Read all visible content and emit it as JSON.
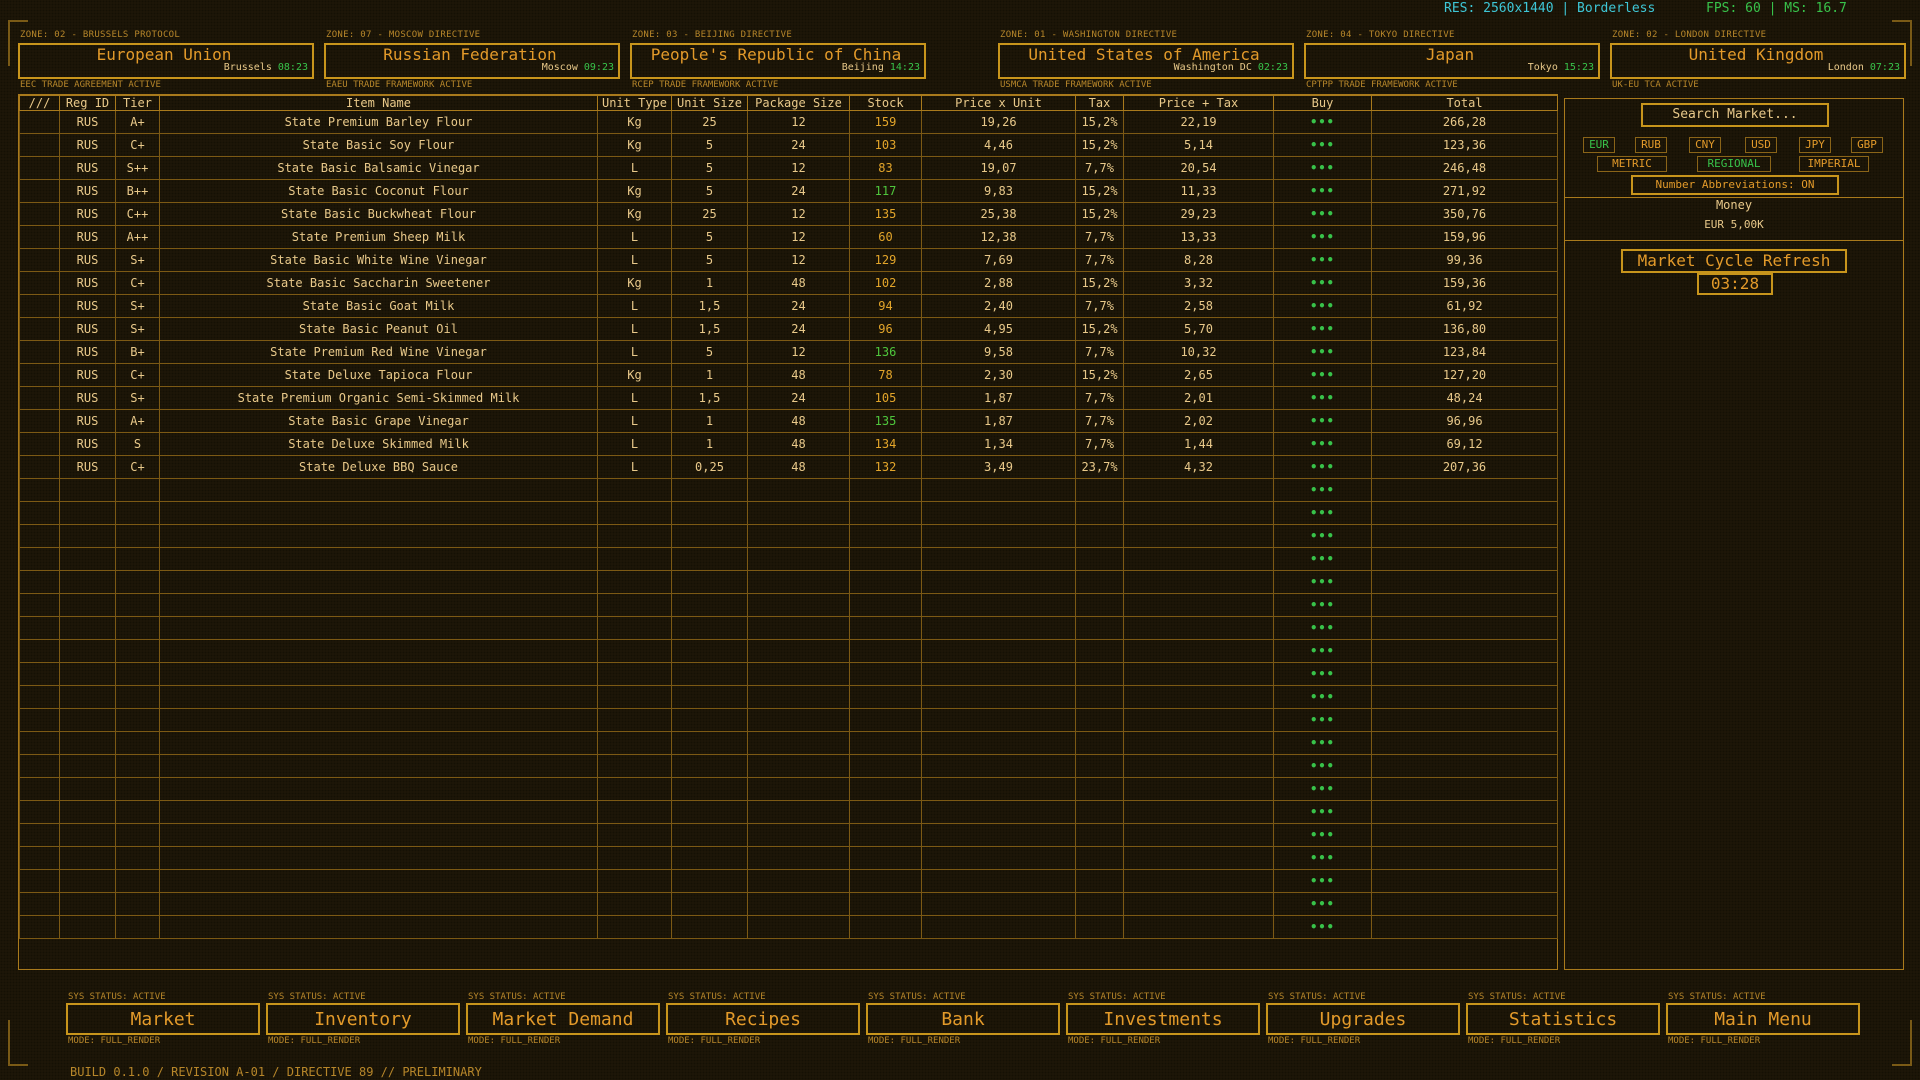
{
  "status": {
    "res": "RES: 2560x1440 | Borderless",
    "fps": "FPS: 60 | MS: 16.7"
  },
  "zones": [
    {
      "label": "ZONE: 02 - BRUSSELS PROTOCOL",
      "name": "European Union",
      "city": "Brussels",
      "time": "08:23",
      "footer": "EEC TRADE AGREEMENT ACTIVE"
    },
    {
      "label": "ZONE: 07 - MOSCOW DIRECTIVE",
      "name": "Russian Federation",
      "city": "Moscow",
      "time": "09:23",
      "footer": "EAEU TRADE FRAMEWORK ACTIVE"
    },
    {
      "label": "ZONE: 03 - BEIJING DIRECTIVE",
      "name": "People's Republic of China",
      "city": "Beijing",
      "time": "14:23",
      "footer": "RCEP TRADE FRAMEWORK ACTIVE"
    },
    {
      "label": "ZONE: 01 - WASHINGTON DIRECTIVE",
      "name": "United States of America",
      "city": "Washington DC",
      "time": "02:23",
      "footer": "USMCA TRADE FRAMEWORK ACTIVE"
    },
    {
      "label": "ZONE: 04 - TOKYO DIRECTIVE",
      "name": "Japan",
      "city": "Tokyo",
      "time": "15:23",
      "footer": "CPTPP TRADE FRAMEWORK ACTIVE"
    },
    {
      "label": "ZONE: 02 - LONDON DIRECTIVE",
      "name": "United Kingdom",
      "city": "London",
      "time": "07:23",
      "footer": "UK-EU TCA ACTIVE"
    }
  ],
  "table": {
    "headers": [
      "///",
      "Reg ID",
      "Tier",
      "Item Name",
      "Unit Type",
      "Unit Size",
      "Package Size",
      "Stock",
      "Price x Unit",
      "Tax",
      "Price + Tax",
      "Buy",
      "Total"
    ],
    "buy_label": "•••",
    "empty_rows": 20,
    "rows": [
      {
        "reg": "RUS",
        "tier": "A+",
        "name": "State Premium Barley Flour",
        "unit": "Kg",
        "usize": "25",
        "pkg": "12",
        "stock": "159",
        "stock_level": "low",
        "price": "19,26",
        "tax": "15,2%",
        "ptax": "22,19",
        "total": "266,28"
      },
      {
        "reg": "RUS",
        "tier": "C+",
        "name": "State Basic Soy Flour",
        "unit": "Kg",
        "usize": "5",
        "pkg": "24",
        "stock": "103",
        "stock_level": "low",
        "price": "4,46",
        "tax": "15,2%",
        "ptax": "5,14",
        "total": "123,36"
      },
      {
        "reg": "RUS",
        "tier": "S++",
        "name": "State Basic Balsamic Vinegar",
        "unit": "L",
        "usize": "5",
        "pkg": "12",
        "stock": "83",
        "stock_level": "low",
        "price": "19,07",
        "tax": "7,7%",
        "ptax": "20,54",
        "total": "246,48"
      },
      {
        "reg": "RUS",
        "tier": "B++",
        "name": "State Basic Coconut Flour",
        "unit": "Kg",
        "usize": "5",
        "pkg": "24",
        "stock": "117",
        "stock_level": "hi",
        "price": "9,83",
        "tax": "15,2%",
        "ptax": "11,33",
        "total": "271,92"
      },
      {
        "reg": "RUS",
        "tier": "C++",
        "name": "State Basic Buckwheat Flour",
        "unit": "Kg",
        "usize": "25",
        "pkg": "12",
        "stock": "135",
        "stock_level": "low",
        "price": "25,38",
        "tax": "15,2%",
        "ptax": "29,23",
        "total": "350,76"
      },
      {
        "reg": "RUS",
        "tier": "A++",
        "name": "State Premium Sheep Milk",
        "unit": "L",
        "usize": "5",
        "pkg": "12",
        "stock": "60",
        "stock_level": "low",
        "price": "12,38",
        "tax": "7,7%",
        "ptax": "13,33",
        "total": "159,96"
      },
      {
        "reg": "RUS",
        "tier": "S+",
        "name": "State Basic White Wine Vinegar",
        "unit": "L",
        "usize": "5",
        "pkg": "12",
        "stock": "129",
        "stock_level": "low",
        "price": "7,69",
        "tax": "7,7%",
        "ptax": "8,28",
        "total": "99,36"
      },
      {
        "reg": "RUS",
        "tier": "C+",
        "name": "State Basic Saccharin Sweetener",
        "unit": "Kg",
        "usize": "1",
        "pkg": "48",
        "stock": "102",
        "stock_level": "low",
        "price": "2,88",
        "tax": "15,2%",
        "ptax": "3,32",
        "total": "159,36"
      },
      {
        "reg": "RUS",
        "tier": "S+",
        "name": "State Basic Goat Milk",
        "unit": "L",
        "usize": "1,5",
        "pkg": "24",
        "stock": "94",
        "stock_level": "low",
        "price": "2,40",
        "tax": "7,7%",
        "ptax": "2,58",
        "total": "61,92"
      },
      {
        "reg": "RUS",
        "tier": "S+",
        "name": "State Basic Peanut Oil",
        "unit": "L",
        "usize": "1,5",
        "pkg": "24",
        "stock": "96",
        "stock_level": "low",
        "price": "4,95",
        "tax": "15,2%",
        "ptax": "5,70",
        "total": "136,80"
      },
      {
        "reg": "RUS",
        "tier": "B+",
        "name": "State Premium Red Wine Vinegar",
        "unit": "L",
        "usize": "5",
        "pkg": "12",
        "stock": "136",
        "stock_level": "hi",
        "price": "9,58",
        "tax": "7,7%",
        "ptax": "10,32",
        "total": "123,84"
      },
      {
        "reg": "RUS",
        "tier": "C+",
        "name": "State Deluxe Tapioca Flour",
        "unit": "Kg",
        "usize": "1",
        "pkg": "48",
        "stock": "78",
        "stock_level": "low",
        "price": "2,30",
        "tax": "15,2%",
        "ptax": "2,65",
        "total": "127,20"
      },
      {
        "reg": "RUS",
        "tier": "S+",
        "name": "State Premium Organic Semi-Skimmed Milk",
        "unit": "L",
        "usize": "1,5",
        "pkg": "24",
        "stock": "105",
        "stock_level": "low",
        "price": "1,87",
        "tax": "7,7%",
        "ptax": "2,01",
        "total": "48,24"
      },
      {
        "reg": "RUS",
        "tier": "A+",
        "name": "State Basic Grape Vinegar",
        "unit": "L",
        "usize": "1",
        "pkg": "48",
        "stock": "135",
        "stock_level": "hi",
        "price": "1,87",
        "tax": "7,7%",
        "ptax": "2,02",
        "total": "96,96"
      },
      {
        "reg": "RUS",
        "tier": "S",
        "name": "State Deluxe Skimmed Milk",
        "unit": "L",
        "usize": "1",
        "pkg": "48",
        "stock": "134",
        "stock_level": "low",
        "price": "1,34",
        "tax": "7,7%",
        "ptax": "1,44",
        "total": "69,12"
      },
      {
        "reg": "RUS",
        "tier": "C+",
        "name": "State Deluxe BBQ Sauce",
        "unit": "L",
        "usize": "0,25",
        "pkg": "48",
        "stock": "132",
        "stock_level": "low",
        "price": "3,49",
        "tax": "23,7%",
        "ptax": "4,32",
        "total": "207,36"
      }
    ]
  },
  "side": {
    "search_placeholder": "Search Market...",
    "currencies": [
      "EUR",
      "RUB",
      "CNY",
      "USD",
      "JPY",
      "GBP"
    ],
    "selected_currency": "EUR",
    "units": [
      "METRIC",
      "REGIONAL",
      "IMPERIAL"
    ],
    "selected_unit": "REGIONAL",
    "abbreviations": "Number Abbreviations: ON",
    "money_label": "Money",
    "money_value": "EUR 5,00K",
    "refresh_label": "Market Cycle Refresh",
    "timer": "03:28"
  },
  "nav": [
    {
      "status": "SYS STATUS: ACTIVE",
      "label": "Market",
      "mode": "MODE: FULL_RENDER"
    },
    {
      "status": "SYS STATUS: ACTIVE",
      "label": "Inventory",
      "mode": "MODE: FULL_RENDER"
    },
    {
      "status": "SYS STATUS: ACTIVE",
      "label": "Market Demand",
      "mode": "MODE: FULL_RENDER"
    },
    {
      "status": "SYS STATUS: ACTIVE",
      "label": "Recipes",
      "mode": "MODE: FULL_RENDER"
    },
    {
      "status": "SYS STATUS: ACTIVE",
      "label": "Bank",
      "mode": "MODE: FULL_RENDER"
    },
    {
      "status": "SYS STATUS: ACTIVE",
      "label": "Investments",
      "mode": "MODE: FULL_RENDER"
    },
    {
      "status": "SYS STATUS: ACTIVE",
      "label": "Upgrades",
      "mode": "MODE: FULL_RENDER"
    },
    {
      "status": "SYS STATUS: ACTIVE",
      "label": "Statistics",
      "mode": "MODE: FULL_RENDER"
    },
    {
      "status": "SYS STATUS: ACTIVE",
      "label": "Main Menu",
      "mode": "MODE: FULL_RENDER"
    }
  ],
  "build": "BUILD 0.1.0 / REVISION A-01 / DIRECTIVE 89 // PRELIMINARY"
}
